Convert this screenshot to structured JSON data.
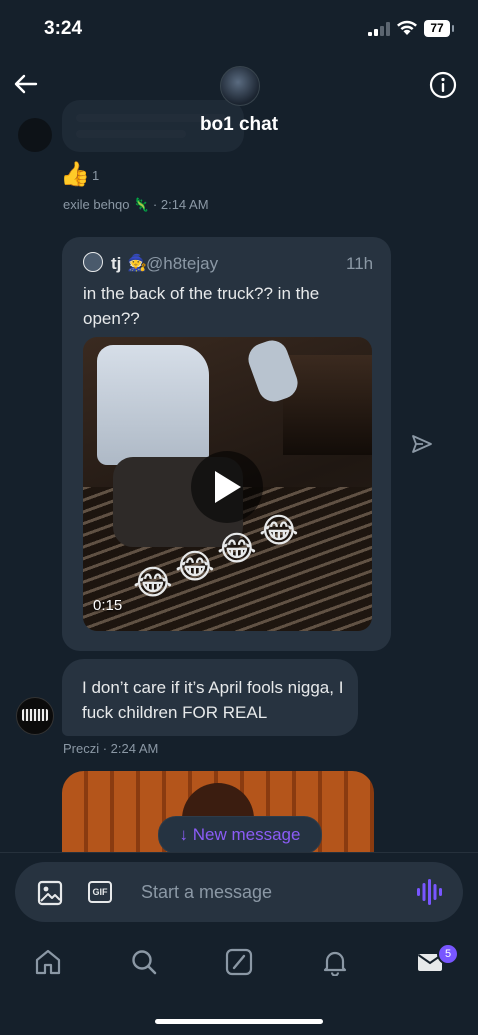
{
  "status_bar": {
    "time": "3:24",
    "battery": "77"
  },
  "header": {
    "title": "bo1 chat"
  },
  "reaction": {
    "emoji": "👍",
    "count": "1"
  },
  "msg1_meta": "exile behqo 🦎 · 2:14 AM",
  "shared_post": {
    "name": "tj",
    "name_emoji": "🧙",
    "handle": "@h8tejay",
    "time": "11h",
    "text": "in the back of the truck?? in the open??",
    "video_duration": "0:15",
    "overlay_emoji": "😂"
  },
  "message": {
    "text": "I don’t care if it’s April fools nigga, I fuck children FOR REAL",
    "meta": "Preczi · 2:24 AM"
  },
  "new_message_pill": "↓ New message",
  "composer": {
    "placeholder": "Start a message",
    "gif_label": "GIF"
  },
  "nav": {
    "messages_badge": "5"
  },
  "colors": {
    "background": "#15202b",
    "bubble": "#273340",
    "accent": "#7856ff",
    "muted": "#8b98a5"
  }
}
